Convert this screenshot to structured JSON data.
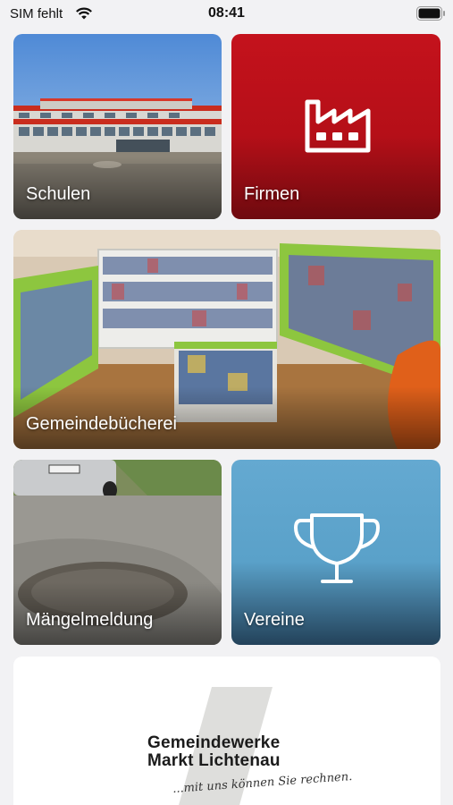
{
  "status_bar": {
    "carrier": "SIM fehlt",
    "time": "08:41"
  },
  "tiles": {
    "schulen": {
      "label": "Schulen"
    },
    "firmen": {
      "label": "Firmen",
      "icon": "factory-icon",
      "color": "#c4121c"
    },
    "buecherei": {
      "label": "Gemeindebücherei"
    },
    "maengel": {
      "label": "Mängelmeldung"
    },
    "vereine": {
      "label": "Vereine",
      "icon": "trophy-icon",
      "color": "#5fa6cf"
    }
  },
  "logo": {
    "line1": "Gemeindewerke",
    "line2": "Markt Lichtenau",
    "tagline": "...mit uns können Sie rechnen."
  }
}
